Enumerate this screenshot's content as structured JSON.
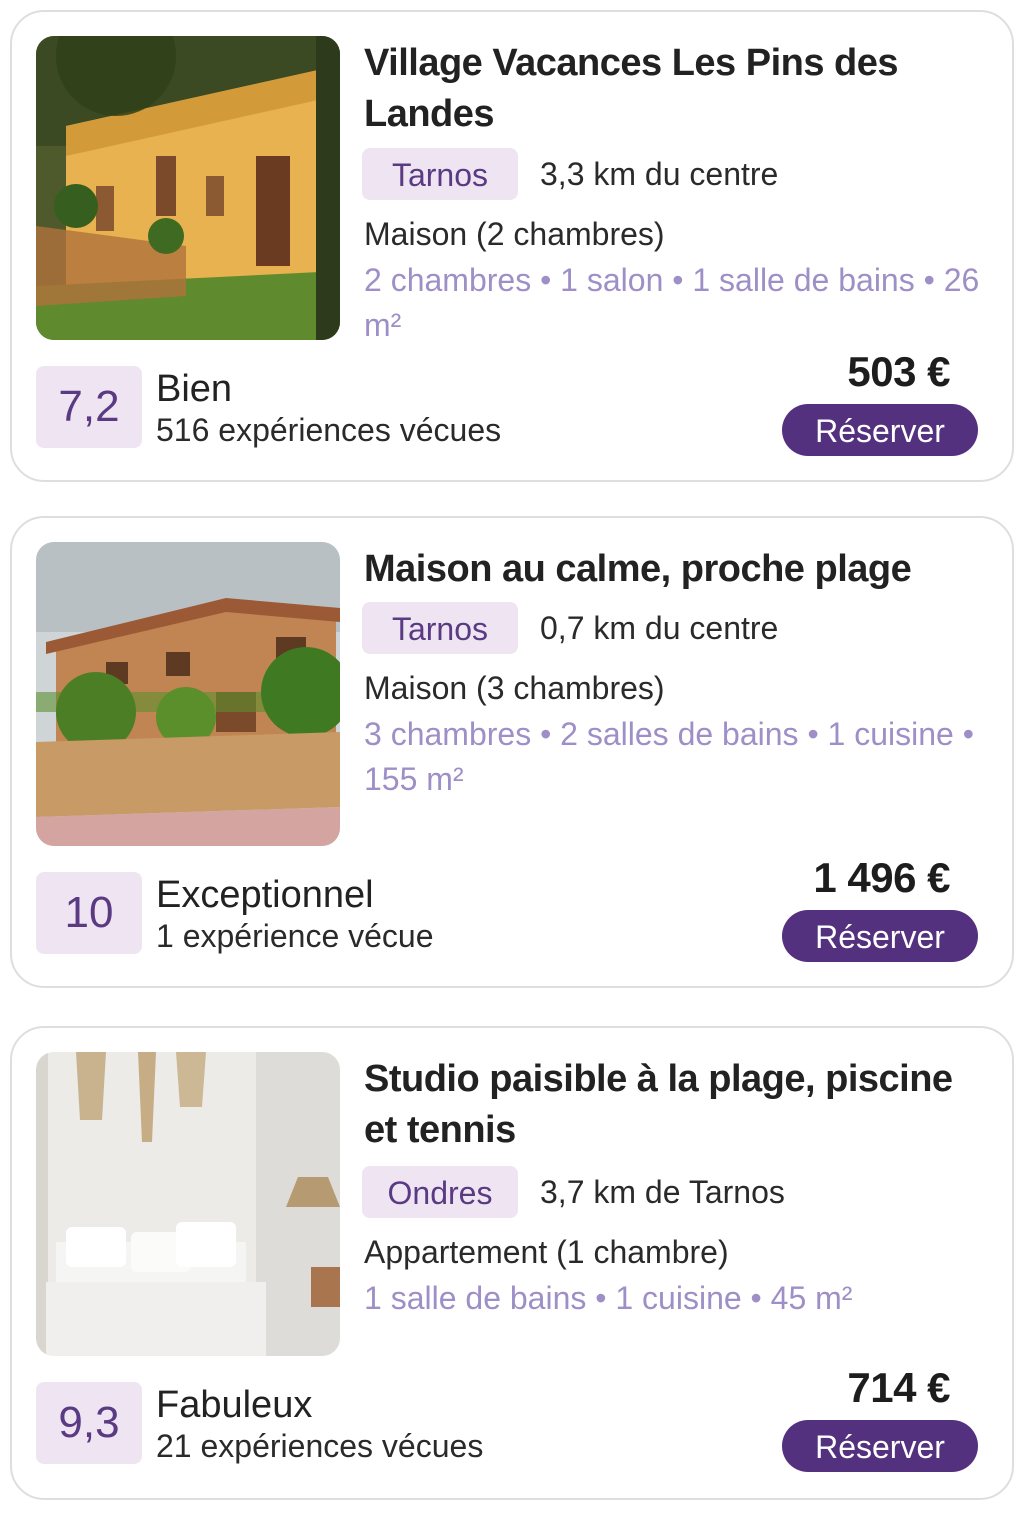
{
  "listings": [
    {
      "title": "Village Vacances Les Pins des Landes",
      "town": "Tarnos",
      "distance": "3,3 km du centre",
      "type": "Maison (2 chambres)",
      "features": "2 chambres • 1 salon • 1 salle de bains • 26 m²",
      "score": "7,2",
      "rating_label": "Bien",
      "reviews": "516 expériences vécues",
      "price": "503 €",
      "book_label": "Réserver",
      "photo": "yellow-villa-with-terrace"
    },
    {
      "title": "Maison au calme, proche plage",
      "town": "Tarnos",
      "distance": "0,7 km du centre",
      "type": "Maison (3 chambres)",
      "features": "3 chambres • 2 salles de bains • 1 cuisine • 155 m²",
      "score": "10",
      "rating_label": "Exceptionnel",
      "reviews": "1 expérience vécue",
      "price": "1 496 €",
      "book_label": "Réserver",
      "photo": "stone-house-with-garden"
    },
    {
      "title": "Studio paisible à la plage, piscine et tennis",
      "town": "Ondres",
      "distance": "3,7 km de Tarnos",
      "type": "Appartement (1 chambre)",
      "features": "1 salle de bains •  1 cuisine • 45 m²",
      "score": "9,3",
      "rating_label": "Fabuleux",
      "reviews": "21 expériences vécues",
      "price": "714 €",
      "book_label": "Réserver",
      "photo": "white-bedroom-with-macrame"
    }
  ],
  "colors": {
    "accent": "#54317f",
    "badge_bg": "#efe4f2",
    "feature_text": "#9e8fc6",
    "card_border": "#dedede"
  }
}
